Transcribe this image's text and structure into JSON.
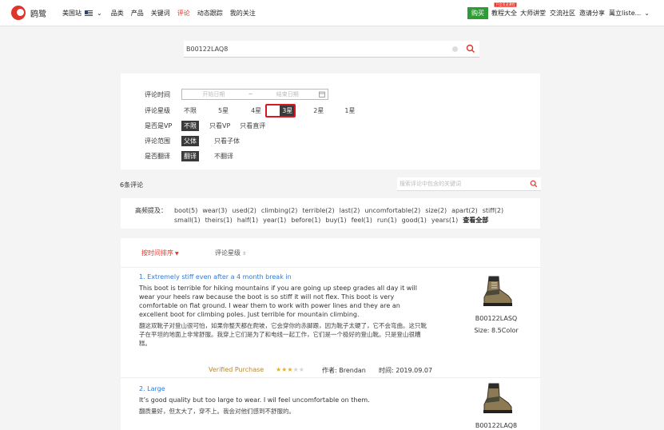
{
  "nav": {
    "logo_text": "鸥鹭",
    "site_label": "美国站",
    "links": [
      "品类",
      "产品",
      "关键词",
      "评论",
      "动态跟踪",
      "我的关注"
    ],
    "active_link": "评论",
    "buy_label": "购买",
    "tutorial_badge": "开会员送课程",
    "tutorial_label": "教程大全",
    "right_links": [
      "大师讲堂",
      "交流社区",
      "邀请分享"
    ],
    "user_name": "萬立liste..."
  },
  "search": {
    "value": "B00122LAQ8"
  },
  "filters": {
    "time_label": "评论时间",
    "start_placeholder": "开始日期",
    "range_sep": "~",
    "end_placeholder": "结束日期",
    "rating_label": "评论星级",
    "rating_options": [
      "不限",
      "5星",
      "4星",
      "3星",
      "2星",
      "1星"
    ],
    "rating_selected": "3星",
    "vp_label": "是否是VP",
    "vp_options": [
      "不限",
      "只看VP",
      "只看直评"
    ],
    "vp_selected": "不限",
    "scope_label": "评论范围",
    "scope_options": [
      "父体",
      "只看子体"
    ],
    "scope_selected": "父体",
    "translate_label": "是否翻译",
    "translate_options": [
      "翻译",
      "不翻译"
    ],
    "translate_selected": "翻译"
  },
  "reviews_count": "6条评论",
  "review_search_placeholder": "搜索评论中包含的关键词",
  "keywords": {
    "title": "高频提及：",
    "line1": [
      "boot(5)",
      "wear(3)",
      "used(2)",
      "climbing(2)",
      "terrible(2)",
      "last(2)",
      "uncomfortable(2)",
      "size(2)",
      "apart(2)",
      "stiff(2)"
    ],
    "line2": [
      "small(1)",
      "theirs(1)",
      "half(1)",
      "year(1)",
      "before(1)",
      "buy(1)",
      "feel(1)",
      "run(1)",
      "good(1)",
      "years(1)"
    ],
    "show_all": "查看全部"
  },
  "sort": {
    "time_label": "按时间排序",
    "rating_label": "评论星级"
  },
  "reviews": [
    {
      "title": "1. Extremely stiff even after a 4 month break in",
      "en": "This boot is terrible for hiking mountains if you are going up steep grades all day it will wear your heels raw because the boot is so stiff it will not flex. This boot is very comfortable on flat ground. I wear them to work with power lines and they are an excellent boot for climbing poles. Just terrible for mountain climbing.",
      "zh": "翻这双靴子对登山很可怕，如果你整天都在爬坡，它会穿你的赤脚跟，因为靴子太硬了，它不会弯曲。这只靴子在平坦的地面上非常舒服。我穿上它们是为了和电线一起工作，它们是一个极好的登山靴。只是登山很糟糕。",
      "asin": "B00122LASQ",
      "size": "Size:  8.5Color",
      "verified": "Verified Purchase",
      "rating": 3,
      "author": "作者: Brendan",
      "time": "时间: 2019.09.07"
    },
    {
      "title": "2. Large",
      "en": "It’s good quality but too large to wear. I wil feel uncomfortable on them.",
      "zh": "翻质量好，但太大了，穿不上。我会对他们感到不舒服的。",
      "asin": "B00122LAQ8"
    }
  ],
  "colors": {
    "accent": "#e0342a",
    "link_blue": "#2f7ad6",
    "buy_green": "#2e9b35",
    "star": "#e8b21e",
    "highlight_red": "#e0141e"
  }
}
